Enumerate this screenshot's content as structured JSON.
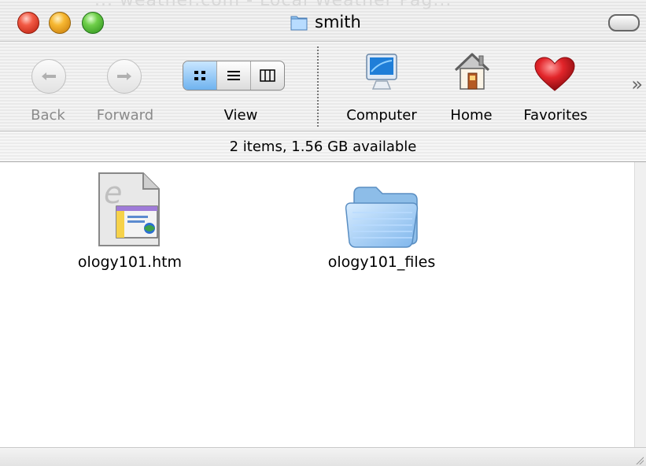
{
  "window": {
    "title": "smith",
    "background_title": "... weather.com - Local Weather Pag..."
  },
  "toolbar": {
    "back_label": "Back",
    "forward_label": "Forward",
    "view_label": "View",
    "computer_label": "Computer",
    "home_label": "Home",
    "favorites_label": "Favorites",
    "overflow_label": "»"
  },
  "status": {
    "text": "2 items, 1.56 GB available"
  },
  "items": [
    {
      "name": "ology101.htm",
      "icon": "ie-html-document-icon"
    },
    {
      "name": "ology101_files",
      "icon": "folder-icon"
    }
  ],
  "colors": {
    "selected_view": "#6fb3ef",
    "close": "#f25a45",
    "minimize": "#f7b832",
    "zoom": "#6fcf4a"
  }
}
